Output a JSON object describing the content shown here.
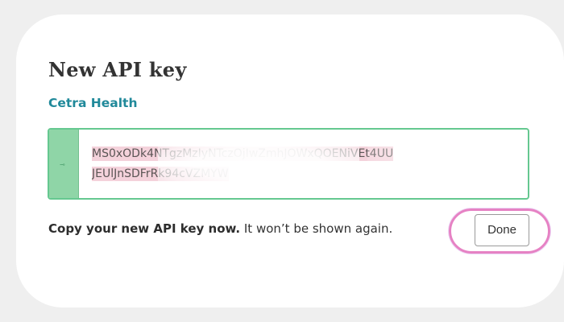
{
  "dialog": {
    "title": "New API key",
    "organization": "Cetra Health",
    "key_icon": "key-icon",
    "api_key": {
      "line1": "MS0xODk4NTgzMzIyNTczO",
      "line1_end": "jIwZmhJOWxQOENiVEt4UU",
      "line2": "JEUlJnSDFrRk94cVZMYW"
    },
    "message_bold": "Copy your new API key now.",
    "message_rest": " It won’t be shown again.",
    "done_label": "Done"
  },
  "colors": {
    "accent_green": "#65c890",
    "org_teal": "#20899a",
    "focus_ring": "#e682c4"
  }
}
